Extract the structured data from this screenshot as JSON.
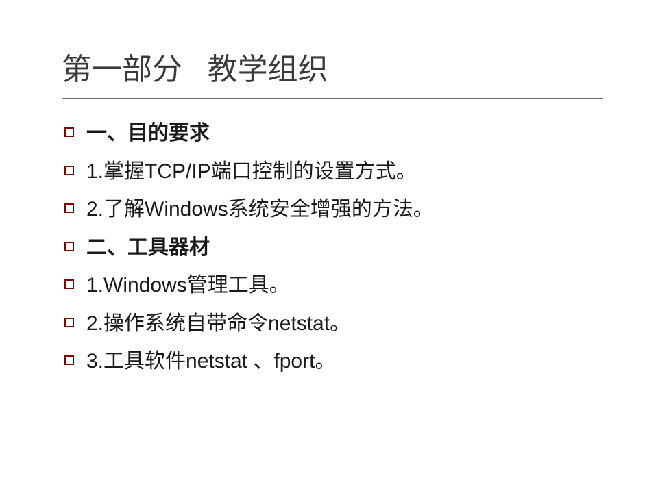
{
  "heading": "第一部分   教学组织",
  "items": [
    {
      "text": "一、目的要求",
      "bold": true
    },
    {
      "text": "1.掌握TCP/IP端口控制的设置方式。",
      "bold": false
    },
    {
      "text": "2.了解Windows系统安全增强的方法。",
      "bold": false
    },
    {
      "text": "二、工具器材",
      "bold": true
    },
    {
      "text": "1.Windows管理工具。",
      "bold": false
    },
    {
      "text": "2.操作系统自带命令netstat。",
      "bold": false
    },
    {
      "text": "3.工具软件netstat 、fport。",
      "bold": false
    }
  ]
}
